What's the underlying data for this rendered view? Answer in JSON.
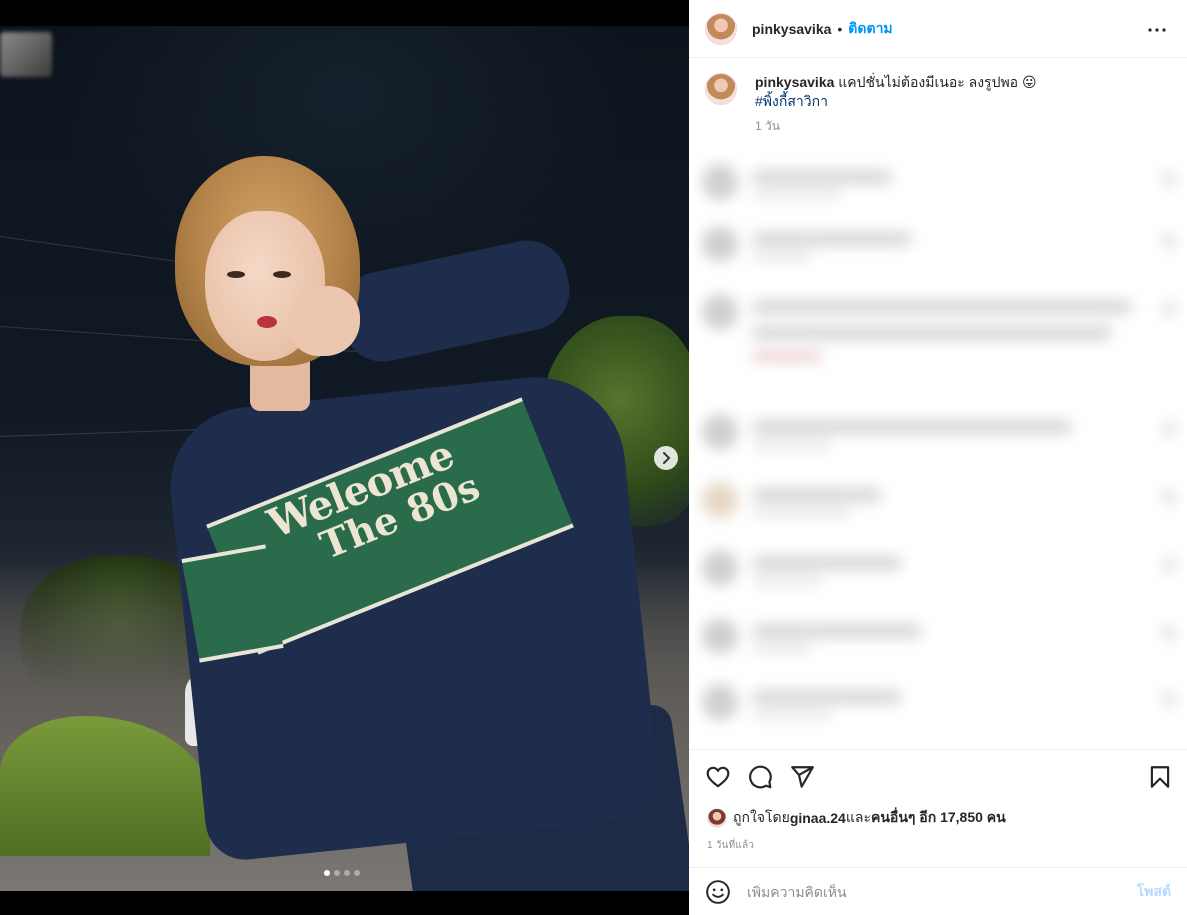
{
  "post": {
    "username": "pinkysavika",
    "separator": "•",
    "follow_label": "ติดตาม",
    "more_icon": "more-horizontal-icon"
  },
  "caption": {
    "username": "pinkysavika",
    "text": " แคปชั่นไม่ต้องมีเนอะ ลงรูปพอ 😛",
    "hashtag": "#พิ้งกี้สาวิกา",
    "time": "1 วัน"
  },
  "photo": {
    "sweater_line1": "Weleome",
    "sweater_line2": "The 80s",
    "carousel": {
      "total": 4,
      "current": 1
    }
  },
  "actions": {
    "like_icon": "heart-icon",
    "comment_icon": "comment-icon",
    "share_icon": "send-icon",
    "save_icon": "bookmark-icon"
  },
  "likes": {
    "prefix": "ถูกใจโดย ",
    "user": "ginaa.24",
    "middle": " และ",
    "others": "คนอื่นๆ อีก 17,850 คน"
  },
  "date": "1 วันที่แล้ว",
  "comment_input": {
    "placeholder": "เพิ่มความคิดเห็น",
    "post_label": "โพสต์"
  },
  "colors": {
    "link_blue": "#0095f6",
    "hashtag_blue": "#00376b",
    "post_disabled": "#b3dbff",
    "muted": "#8e8e8e"
  }
}
